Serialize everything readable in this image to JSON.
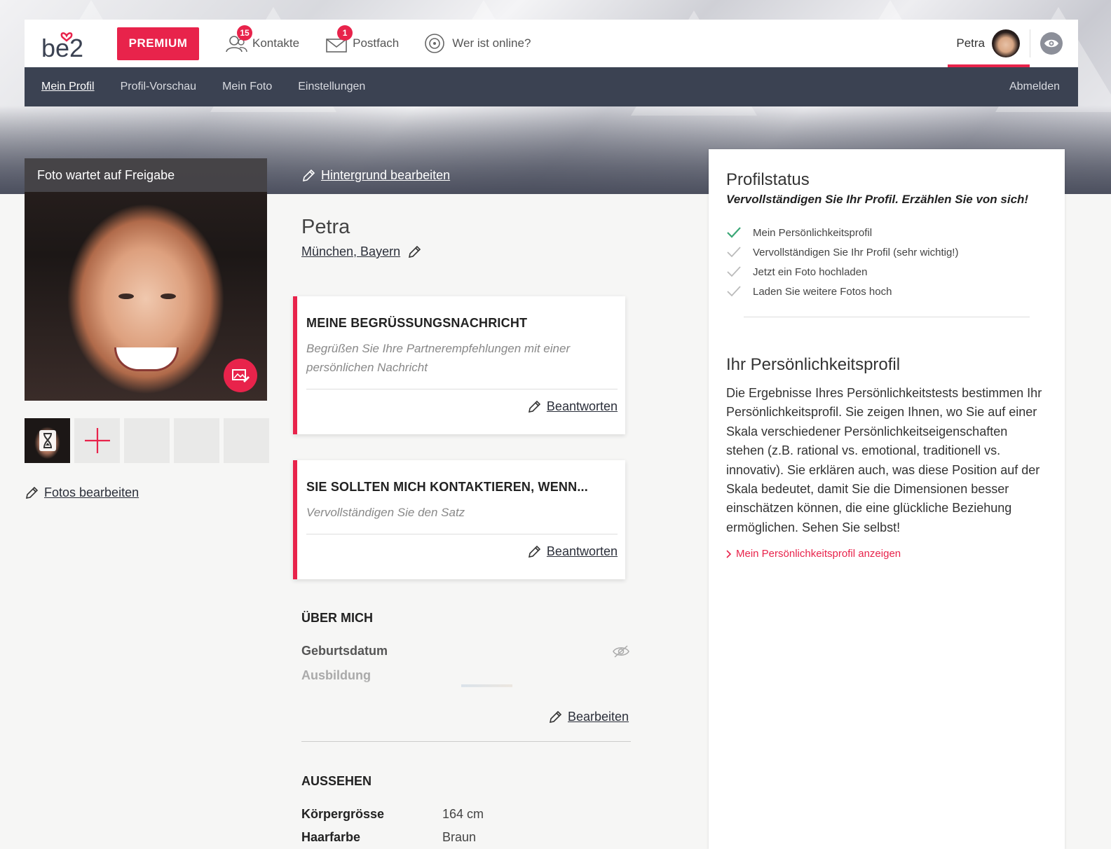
{
  "header": {
    "logo_text": "be2",
    "premium_label": "PREMIUM",
    "contacts": {
      "label": "Kontakte",
      "badge": "15"
    },
    "postfach": {
      "label": "Postfach",
      "badge": "1"
    },
    "online": {
      "label": "Wer ist online?"
    },
    "user_name": "Petra"
  },
  "subnav": {
    "items": [
      "Mein Profil",
      "Profil-Vorschau",
      "Mein Foto",
      "Einstellungen"
    ],
    "logout": "Abmelden"
  },
  "photo": {
    "caption": "Foto wartet auf Freigabe",
    "edit_link": "Fotos bearbeiten"
  },
  "profile": {
    "background_edit": "Hintergrund bearbeiten",
    "name": "Petra",
    "location": "München, Bayern"
  },
  "cards": [
    {
      "title": "MEINE BEGRÜSSUNGSNACHRICHT",
      "hint": "Begrüßen Sie Ihre Partnerempfehlungen mit einer persönlichen Nachricht",
      "action": "Beantworten"
    },
    {
      "title": "SIE SOLLTEN MICH KONTAKTIEREN, WENN...",
      "hint": "Vervollständigen Sie den Satz",
      "action": "Beantworten"
    }
  ],
  "about": {
    "title": "ÜBER MICH",
    "fields": [
      "Geburtsdatum",
      "Ausbildung"
    ],
    "edit": "Bearbeiten"
  },
  "appearance": {
    "title": "AUSSEHEN",
    "rows": [
      {
        "key": "Körpergrösse",
        "value": "164 cm"
      },
      {
        "key": "Haarfarbe",
        "value": "Braun"
      }
    ]
  },
  "status": {
    "title": "Profilstatus",
    "subtitle": "Vervollständigen Sie Ihr Profil. Erzählen Sie von sich!",
    "items": [
      {
        "label": "Mein Persönlichkeitsprofil",
        "done": true
      },
      {
        "label": "Vervollständigen Sie Ihr Profil (sehr wichtig!)",
        "done": false
      },
      {
        "label": "Jetzt ein Foto hochladen",
        "done": false
      },
      {
        "label": "Laden Sie weitere Fotos hoch",
        "done": false
      }
    ],
    "colors": {
      "done": "#3aa776",
      "pending": "#bbbbbb",
      "accent": "#e8234b"
    }
  },
  "personality": {
    "title": "Ihr Persönlichkeitsprofil",
    "text": "Die Ergebnisse Ihres Persönlichkeitstests bestimmen Ihr Persönlichkeitsprofil. Sie zeigen Ihnen, wo Sie auf einer Skala verschiedener Persönlichkeitseigenschaften stehen (z.B. rational vs. emotional, traditionell vs. innovativ). Sie erklären auch, was diese Position auf der Skala bedeutet, damit Sie die Dimensionen besser einschätzen können, die eine glückliche Beziehung ermöglichen. Sehen Sie selbst!",
    "link": "Mein Persönlichkeitsprofil anzeigen"
  }
}
